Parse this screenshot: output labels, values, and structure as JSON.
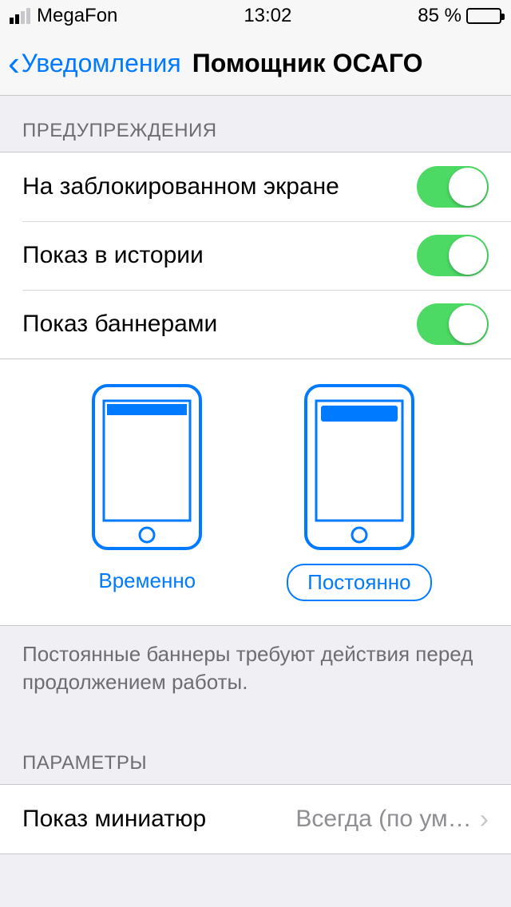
{
  "status": {
    "carrier": "MegaFon",
    "time": "13:02",
    "battery_pct": "85 %"
  },
  "nav": {
    "back_label": "Уведомления",
    "title": "Помощник ОСАГО"
  },
  "sections": {
    "alerts_header": "ПРЕДУПРЕЖДЕНИЯ",
    "rows": {
      "lock_screen": "На заблокированном экране",
      "history": "Показ в истории",
      "banners": "Показ баннерами"
    },
    "banner_style": {
      "temporary": "Временно",
      "persistent": "Постоянно",
      "selected": "Постоянно"
    },
    "footer": "Постоянные баннеры требуют действия перед продолжением работы.",
    "options_header": "ПАРАМЕТРЫ",
    "previews": {
      "label": "Показ миниатюр",
      "value": "Всегда (по ум…"
    }
  }
}
